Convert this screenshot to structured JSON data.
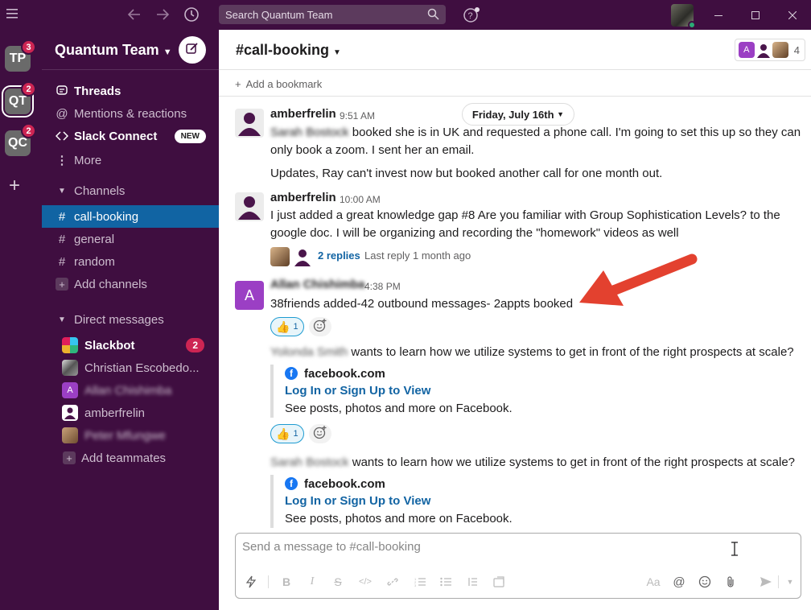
{
  "search": {
    "placeholder": "Search Quantum Team"
  },
  "workspaces": [
    {
      "initials": "TP",
      "badge": "3"
    },
    {
      "initials": "QT",
      "badge": "2"
    },
    {
      "initials": "QC",
      "badge": "2"
    }
  ],
  "sidebar": {
    "team_name": "Quantum Team",
    "nav": {
      "threads": "Threads",
      "mentions": "Mentions & reactions",
      "slack_connect": "Slack Connect",
      "slack_connect_badge": "NEW",
      "more": "More"
    },
    "channels_header": "Channels",
    "channels": [
      "call-booking",
      "general",
      "random"
    ],
    "add_channels": "Add channels",
    "dm_header": "Direct messages",
    "dms": [
      {
        "name": "Slackbot",
        "badge": "2"
      },
      {
        "name": "Christian Escobedo..."
      },
      {
        "name": "Allan Chishimba"
      },
      {
        "name": "amberfrelin"
      },
      {
        "name": "Peter Mfungwe"
      }
    ],
    "add_teammates": "Add teammates"
  },
  "channel": {
    "name": "call-booking",
    "member_count": "4",
    "bookmark": "Add a bookmark",
    "date_divider": "Friday, July 16th"
  },
  "messages": {
    "m1": {
      "author": "amberfrelin",
      "time": "9:51 AM",
      "mention": "Sarah Bostock",
      "text_line1": "booked she is in UK and requested a phone call. I'm going to set this up so they can",
      "text_line2": "only book a zoom. I sent her an email.",
      "text_followup": "Updates, Ray can't invest now but booked another call for one month out."
    },
    "m2": {
      "author": "amberfrelin",
      "time": "10:00 AM",
      "text_line1": "I just added a great knowledge gap #8  Are you familiar with Group Sophistication Levels? to the",
      "text_line2": "google doc. I will be organizing and recording the \"homework\" videos as well",
      "replies": "2 replies",
      "last_reply": "Last reply 1 month ago"
    },
    "m3": {
      "avatar_letter": "A",
      "author": "Allan Chishimba",
      "time": "4:38 PM",
      "text": "38friends added-42 outbound messages- 2appts booked",
      "reaction_count": "1"
    },
    "m4": {
      "who": "Yolonda Smith",
      "text": "wants to learn how we utilize systems to get in front of the right prospects at scale?",
      "attach_site": "facebook.com",
      "attach_title": "Log In or Sign Up to View",
      "attach_desc": "See posts, photos and more on Facebook.",
      "reaction_count": "1"
    },
    "m5": {
      "who": "Sarah Bostock",
      "text": "wants to learn how we utilize systems to get in front of the right prospects at scale?",
      "attach_site": "facebook.com",
      "attach_title": "Log In or Sign Up to View",
      "attach_desc": "See posts, photos and more on Facebook."
    }
  },
  "composer": {
    "placeholder": "Send a message to #call-booking",
    "format_aa": "Aa",
    "format_at": "@"
  },
  "colors": {
    "aubergine": "#3f0e40",
    "active_channel": "#1164a3",
    "badge_red": "#cd2553",
    "link_blue": "#1264a3",
    "arrow_red": "#e3412f"
  }
}
